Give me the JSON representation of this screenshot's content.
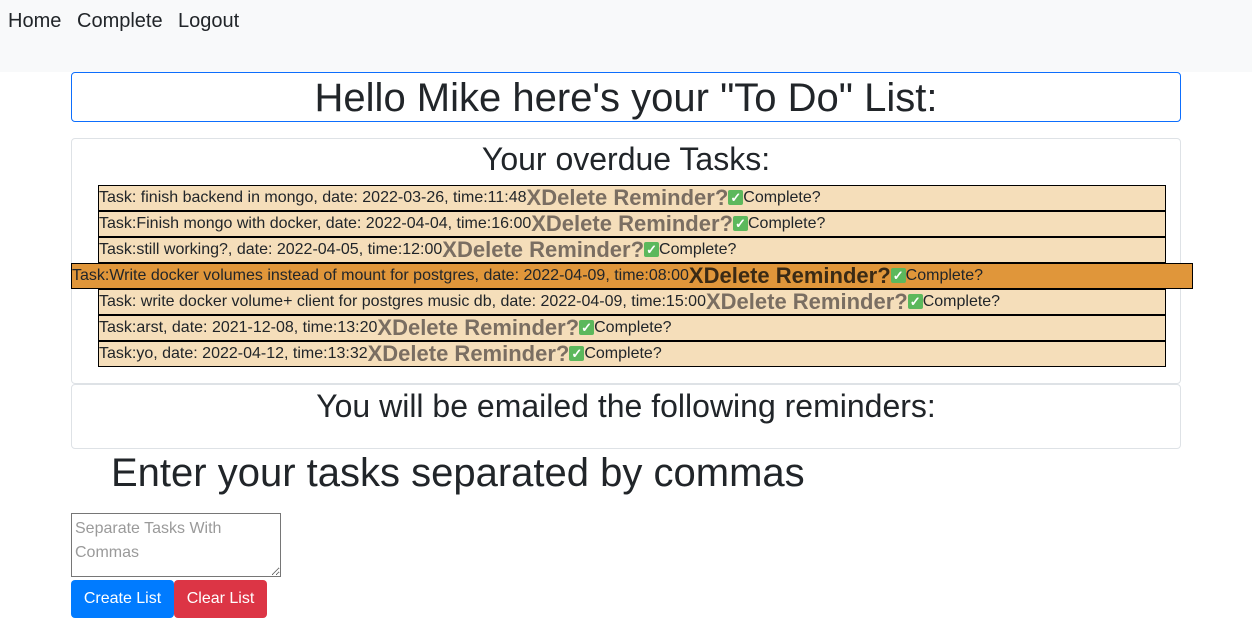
{
  "nav": {
    "home": "Home",
    "complete": "Complete",
    "logout": "Logout"
  },
  "greeting": "Hello Mike here's your \"To Do\" List:",
  "overdue": {
    "title": "Your overdue Tasks:",
    "delete_label": "XDelete Reminder?",
    "complete_label": "Complete?",
    "check_glyph": "✓",
    "tasks": [
      "Task: finish backend in mongo, date: 2022-03-26, time:11:48",
      "Task:Finish mongo with docker, date: 2022-04-04, time:16:00",
      "Task:still working?, date: 2022-04-05, time:12:00",
      "Task:Write docker volumes instead of mount for postgres, date: 2022-04-09, time:08:00",
      "Task: write docker volume+ client for postgres music db, date: 2022-04-09, time:15:00",
      "Task:arst, date: 2021-12-08, time:13:20",
      "Task:yo, date: 2022-04-12, time:13:32"
    ]
  },
  "reminders_title": "You will be emailed the following reminders:",
  "enter_heading": "Enter your tasks separated by commas",
  "input": {
    "placeholder": "Separate Tasks With Commas",
    "value": ""
  },
  "buttons": {
    "create": "Create List",
    "clear": "Clear List"
  },
  "colors": {
    "row_bg": "#f5deba",
    "row_highlight": "#e0963a",
    "primary": "#007bff",
    "danger": "#dc3545"
  }
}
